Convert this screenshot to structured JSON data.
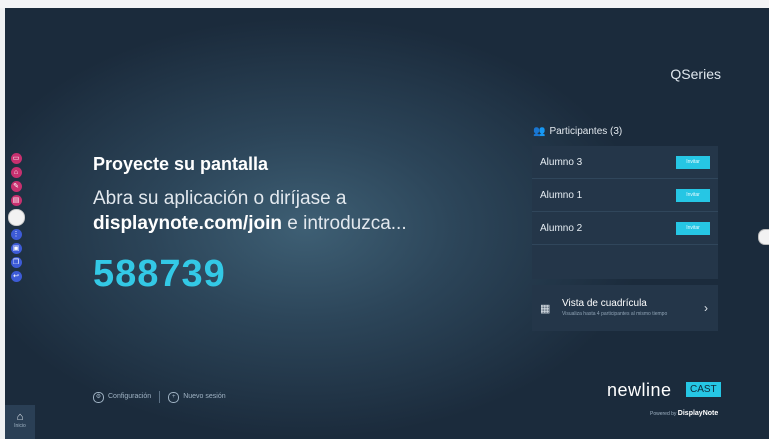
{
  "brand": {
    "series": "QSeries",
    "newline": "newline",
    "cast": "CAST",
    "powered_prefix": "Powered by",
    "powered_brand": "DisplayNote"
  },
  "main": {
    "title": "Proyecte su pantalla",
    "instruction_line1": "Abra su aplicación o diríjase a",
    "instruction_url": "displaynote.com/join",
    "instruction_rest": " e introduzca...",
    "code": "588739"
  },
  "participants": {
    "header": "Participantes (3)",
    "invite_label": "Invitar",
    "list": [
      {
        "name": "Alumno 3"
      },
      {
        "name": "Alumno 1"
      },
      {
        "name": "Alumno 2"
      }
    ]
  },
  "grid": {
    "title": "Vista de cuadrícula",
    "description": "Visualiza hasta 4 participantes al mismo tiempo"
  },
  "footer": {
    "config_label": "Configuración",
    "new_session_label": "Nuevo sesión"
  },
  "home": {
    "label": "Inicio"
  },
  "icons": [
    "cast-icon",
    "home-icon",
    "annotate-icon",
    "whiteboard-icon",
    "apps-icon",
    "source-icon",
    "window-icon",
    "back-icon",
    "gear-icon",
    "plus-icon",
    "grid-icon",
    "people-icon",
    "chevron-right-icon"
  ],
  "colors": {
    "accent": "#26c6e4",
    "code": "#33c9e6",
    "toolbar": "#c7306f"
  }
}
